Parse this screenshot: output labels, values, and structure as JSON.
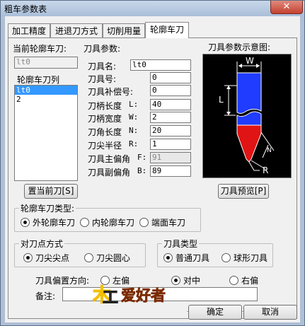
{
  "window": {
    "title": "粗车参数表",
    "close_glyph": "✕"
  },
  "tabs": [
    {
      "label": "加工精度"
    },
    {
      "label": "进退刀方式"
    },
    {
      "label": "切削用量"
    },
    {
      "label": "轮廓车刀"
    }
  ],
  "current_tool": {
    "label": "当前轮廓车刀:",
    "value": "lt0"
  },
  "tool_list": {
    "label": "轮廓车刀列",
    "items": [
      "lt0",
      "2"
    ],
    "selected": 0
  },
  "set_current_button": "置当前刀[S]",
  "params": {
    "label": "刀具参数:",
    "rows": [
      {
        "label": "刀具名:",
        "value": "lt0"
      },
      {
        "label": "刀具号:",
        "value": "0"
      },
      {
        "label": "刀具补偿号:",
        "value": "0"
      },
      {
        "label": "刀柄长度",
        "sym": "L:",
        "value": "40"
      },
      {
        "label": "刀柄宽度",
        "sym": "W:",
        "value": "2"
      },
      {
        "label": "刀角长度",
        "sym": "N:",
        "value": "20"
      },
      {
        "label": "刀尖半径",
        "sym": "R:",
        "value": "1"
      },
      {
        "label": "刀具主偏角",
        "sym": "F:",
        "value": "91"
      },
      {
        "label": "刀具副偏角",
        "sym": "B:",
        "value": "89"
      }
    ]
  },
  "diagram": {
    "label": "刀具参数示意图:",
    "labels": {
      "w": "W",
      "l": "L",
      "n": "N",
      "r": "R"
    }
  },
  "preview_button": "刀具预览[P]",
  "tool_type_group": {
    "title": "轮廓车刀类型:",
    "options": [
      "外轮廓车刀",
      "内轮廓车刀",
      "端面车刀"
    ],
    "selected": 0
  },
  "point_group": {
    "title": "对刀点方式",
    "options": [
      "刀尖尖点",
      "刀尖圆心"
    ],
    "selected": 0
  },
  "kind_group": {
    "title": "刀具类型",
    "options": [
      "普通刀具",
      "球形刀具"
    ],
    "selected": 0
  },
  "offset": {
    "label": "刀具偏置方向:",
    "options": [
      "左偏",
      "对中",
      "右偏"
    ],
    "selected": 1
  },
  "remark": {
    "label": "备注:",
    "value": ""
  },
  "watermark": {
    "text": "爱好者"
  },
  "ok_button": "确定",
  "cancel_button": "取消",
  "colors": {
    "diagram_bg": "#000000",
    "tool_blue": "#1f3cff",
    "tool_red": "#e01414"
  }
}
